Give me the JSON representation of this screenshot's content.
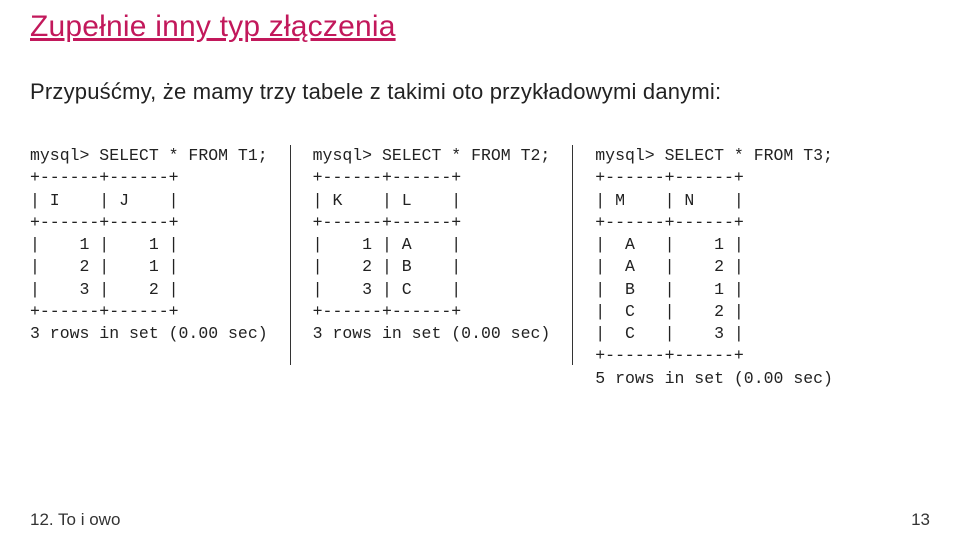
{
  "title": "Zupełnie inny typ złączenia",
  "intro": "Przypuśćmy, że mamy trzy tabele z takimi oto przykładowymi danymi:",
  "tables": {
    "t1": {
      "query": "mysql> SELECT * FROM T1;",
      "border": "+------+------+",
      "header": "| I    | J    |",
      "rows": [
        "|    1 |    1 |",
        "|    2 |    1 |",
        "|    3 |    2 |"
      ],
      "footer": "3 rows in set (0.00 sec)"
    },
    "t2": {
      "query": "mysql> SELECT * FROM T2;",
      "border": "+------+------+",
      "header": "| K    | L    |",
      "rows": [
        "|    1 | A    |",
        "|    2 | B    |",
        "|    3 | C    |"
      ],
      "footer": "3 rows in set (0.00 sec)"
    },
    "t3": {
      "query": "mysql> SELECT * FROM T3;",
      "border": "+------+------+",
      "header": "| M    | N    |",
      "rows": [
        "|  A   |    1 |",
        "|  A   |    2 |",
        "|  B   |    1 |",
        "|  C   |    2 |",
        "|  C   |    3 |"
      ],
      "footer": "5 rows in set (0.00 sec)"
    }
  },
  "chart_data": [
    {
      "type": "table",
      "name": "T1",
      "columns": [
        "I",
        "J"
      ],
      "rows": [
        [
          1,
          1
        ],
        [
          2,
          1
        ],
        [
          3,
          2
        ]
      ],
      "row_count": 3
    },
    {
      "type": "table",
      "name": "T2",
      "columns": [
        "K",
        "L"
      ],
      "rows": [
        [
          1,
          "A"
        ],
        [
          2,
          "B"
        ],
        [
          3,
          "C"
        ]
      ],
      "row_count": 3
    },
    {
      "type": "table",
      "name": "T3",
      "columns": [
        "M",
        "N"
      ],
      "rows": [
        [
          "A",
          1
        ],
        [
          "A",
          2
        ],
        [
          "B",
          1
        ],
        [
          "C",
          2
        ],
        [
          "C",
          3
        ]
      ],
      "row_count": 5
    }
  ],
  "footer": {
    "left": "12. To i owo",
    "right": "13"
  }
}
